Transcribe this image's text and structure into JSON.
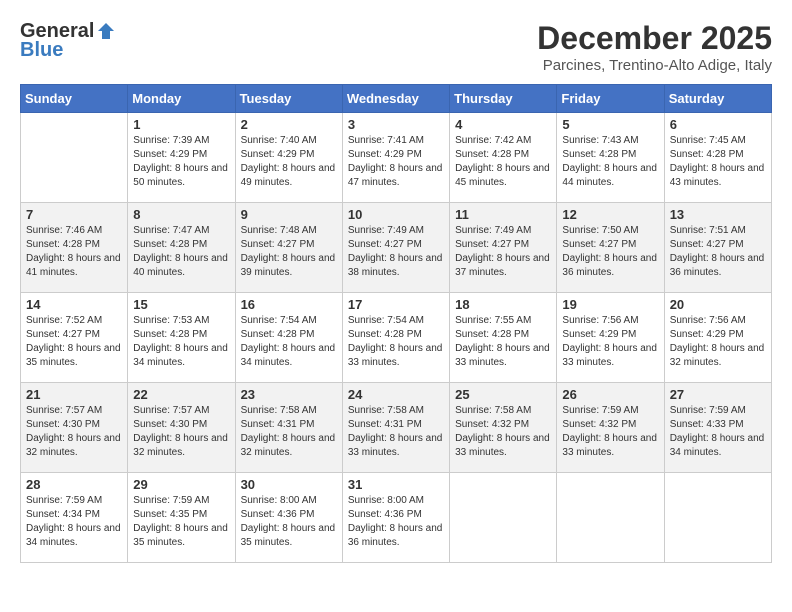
{
  "header": {
    "logo_general": "General",
    "logo_blue": "Blue",
    "month_title": "December 2025",
    "location": "Parcines, Trentino-Alto Adige, Italy"
  },
  "weekdays": [
    "Sunday",
    "Monday",
    "Tuesday",
    "Wednesday",
    "Thursday",
    "Friday",
    "Saturday"
  ],
  "weeks": [
    [
      {
        "day": "",
        "sunrise": "",
        "sunset": "",
        "daylight": ""
      },
      {
        "day": "1",
        "sunrise": "Sunrise: 7:39 AM",
        "sunset": "Sunset: 4:29 PM",
        "daylight": "Daylight: 8 hours and 50 minutes."
      },
      {
        "day": "2",
        "sunrise": "Sunrise: 7:40 AM",
        "sunset": "Sunset: 4:29 PM",
        "daylight": "Daylight: 8 hours and 49 minutes."
      },
      {
        "day": "3",
        "sunrise": "Sunrise: 7:41 AM",
        "sunset": "Sunset: 4:29 PM",
        "daylight": "Daylight: 8 hours and 47 minutes."
      },
      {
        "day": "4",
        "sunrise": "Sunrise: 7:42 AM",
        "sunset": "Sunset: 4:28 PM",
        "daylight": "Daylight: 8 hours and 45 minutes."
      },
      {
        "day": "5",
        "sunrise": "Sunrise: 7:43 AM",
        "sunset": "Sunset: 4:28 PM",
        "daylight": "Daylight: 8 hours and 44 minutes."
      },
      {
        "day": "6",
        "sunrise": "Sunrise: 7:45 AM",
        "sunset": "Sunset: 4:28 PM",
        "daylight": "Daylight: 8 hours and 43 minutes."
      }
    ],
    [
      {
        "day": "7",
        "sunrise": "Sunrise: 7:46 AM",
        "sunset": "Sunset: 4:28 PM",
        "daylight": "Daylight: 8 hours and 41 minutes."
      },
      {
        "day": "8",
        "sunrise": "Sunrise: 7:47 AM",
        "sunset": "Sunset: 4:28 PM",
        "daylight": "Daylight: 8 hours and 40 minutes."
      },
      {
        "day": "9",
        "sunrise": "Sunrise: 7:48 AM",
        "sunset": "Sunset: 4:27 PM",
        "daylight": "Daylight: 8 hours and 39 minutes."
      },
      {
        "day": "10",
        "sunrise": "Sunrise: 7:49 AM",
        "sunset": "Sunset: 4:27 PM",
        "daylight": "Daylight: 8 hours and 38 minutes."
      },
      {
        "day": "11",
        "sunrise": "Sunrise: 7:49 AM",
        "sunset": "Sunset: 4:27 PM",
        "daylight": "Daylight: 8 hours and 37 minutes."
      },
      {
        "day": "12",
        "sunrise": "Sunrise: 7:50 AM",
        "sunset": "Sunset: 4:27 PM",
        "daylight": "Daylight: 8 hours and 36 minutes."
      },
      {
        "day": "13",
        "sunrise": "Sunrise: 7:51 AM",
        "sunset": "Sunset: 4:27 PM",
        "daylight": "Daylight: 8 hours and 36 minutes."
      }
    ],
    [
      {
        "day": "14",
        "sunrise": "Sunrise: 7:52 AM",
        "sunset": "Sunset: 4:27 PM",
        "daylight": "Daylight: 8 hours and 35 minutes."
      },
      {
        "day": "15",
        "sunrise": "Sunrise: 7:53 AM",
        "sunset": "Sunset: 4:28 PM",
        "daylight": "Daylight: 8 hours and 34 minutes."
      },
      {
        "day": "16",
        "sunrise": "Sunrise: 7:54 AM",
        "sunset": "Sunset: 4:28 PM",
        "daylight": "Daylight: 8 hours and 34 minutes."
      },
      {
        "day": "17",
        "sunrise": "Sunrise: 7:54 AM",
        "sunset": "Sunset: 4:28 PM",
        "daylight": "Daylight: 8 hours and 33 minutes."
      },
      {
        "day": "18",
        "sunrise": "Sunrise: 7:55 AM",
        "sunset": "Sunset: 4:28 PM",
        "daylight": "Daylight: 8 hours and 33 minutes."
      },
      {
        "day": "19",
        "sunrise": "Sunrise: 7:56 AM",
        "sunset": "Sunset: 4:29 PM",
        "daylight": "Daylight: 8 hours and 33 minutes."
      },
      {
        "day": "20",
        "sunrise": "Sunrise: 7:56 AM",
        "sunset": "Sunset: 4:29 PM",
        "daylight": "Daylight: 8 hours and 32 minutes."
      }
    ],
    [
      {
        "day": "21",
        "sunrise": "Sunrise: 7:57 AM",
        "sunset": "Sunset: 4:30 PM",
        "daylight": "Daylight: 8 hours and 32 minutes."
      },
      {
        "day": "22",
        "sunrise": "Sunrise: 7:57 AM",
        "sunset": "Sunset: 4:30 PM",
        "daylight": "Daylight: 8 hours and 32 minutes."
      },
      {
        "day": "23",
        "sunrise": "Sunrise: 7:58 AM",
        "sunset": "Sunset: 4:31 PM",
        "daylight": "Daylight: 8 hours and 32 minutes."
      },
      {
        "day": "24",
        "sunrise": "Sunrise: 7:58 AM",
        "sunset": "Sunset: 4:31 PM",
        "daylight": "Daylight: 8 hours and 33 minutes."
      },
      {
        "day": "25",
        "sunrise": "Sunrise: 7:58 AM",
        "sunset": "Sunset: 4:32 PM",
        "daylight": "Daylight: 8 hours and 33 minutes."
      },
      {
        "day": "26",
        "sunrise": "Sunrise: 7:59 AM",
        "sunset": "Sunset: 4:32 PM",
        "daylight": "Daylight: 8 hours and 33 minutes."
      },
      {
        "day": "27",
        "sunrise": "Sunrise: 7:59 AM",
        "sunset": "Sunset: 4:33 PM",
        "daylight": "Daylight: 8 hours and 34 minutes."
      }
    ],
    [
      {
        "day": "28",
        "sunrise": "Sunrise: 7:59 AM",
        "sunset": "Sunset: 4:34 PM",
        "daylight": "Daylight: 8 hours and 34 minutes."
      },
      {
        "day": "29",
        "sunrise": "Sunrise: 7:59 AM",
        "sunset": "Sunset: 4:35 PM",
        "daylight": "Daylight: 8 hours and 35 minutes."
      },
      {
        "day": "30",
        "sunrise": "Sunrise: 8:00 AM",
        "sunset": "Sunset: 4:36 PM",
        "daylight": "Daylight: 8 hours and 35 minutes."
      },
      {
        "day": "31",
        "sunrise": "Sunrise: 8:00 AM",
        "sunset": "Sunset: 4:36 PM",
        "daylight": "Daylight: 8 hours and 36 minutes."
      },
      {
        "day": "",
        "sunrise": "",
        "sunset": "",
        "daylight": ""
      },
      {
        "day": "",
        "sunrise": "",
        "sunset": "",
        "daylight": ""
      },
      {
        "day": "",
        "sunrise": "",
        "sunset": "",
        "daylight": ""
      }
    ]
  ]
}
